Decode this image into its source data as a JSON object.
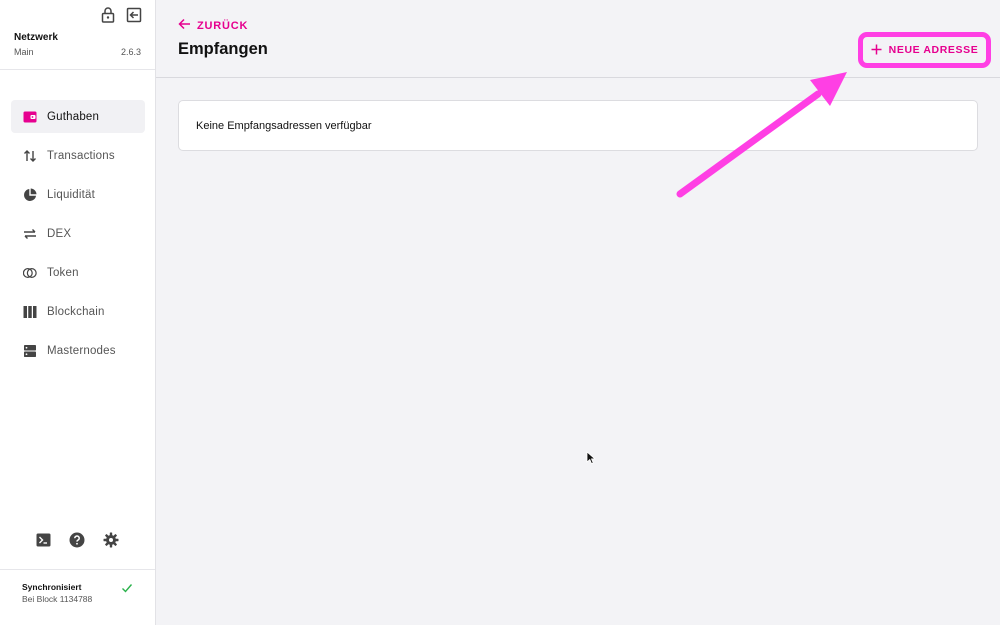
{
  "sidebar": {
    "network_title": "Netzwerk",
    "network_name": "Main",
    "version": "2.6.3",
    "items": [
      {
        "label": "Guthaben",
        "icon": "wallet-icon",
        "active": true
      },
      {
        "label": "Transactions",
        "icon": "transfer-arrows-icon",
        "active": false
      },
      {
        "label": "Liquidität",
        "icon": "pie-chart-icon",
        "active": false
      },
      {
        "label": "DEX",
        "icon": "swap-arrows-icon",
        "active": false
      },
      {
        "label": "Token",
        "icon": "token-icon",
        "active": false
      },
      {
        "label": "Blockchain",
        "icon": "blockchain-icon",
        "active": false
      },
      {
        "label": "Masternodes",
        "icon": "server-icon",
        "active": false
      }
    ],
    "sync": {
      "title": "Synchronisiert",
      "subtitle": "Bei Block 1134788"
    }
  },
  "header": {
    "back_label": "ZURÜCK",
    "title": "Empfangen",
    "new_address_label": "NEUE ADRESSE"
  },
  "main": {
    "empty_message": "Keine Empfangsadressen verfügbar"
  },
  "colors": {
    "accent": "#e6008f",
    "annotation": "#ff3fe4",
    "sync_ok": "#2bb24c"
  }
}
